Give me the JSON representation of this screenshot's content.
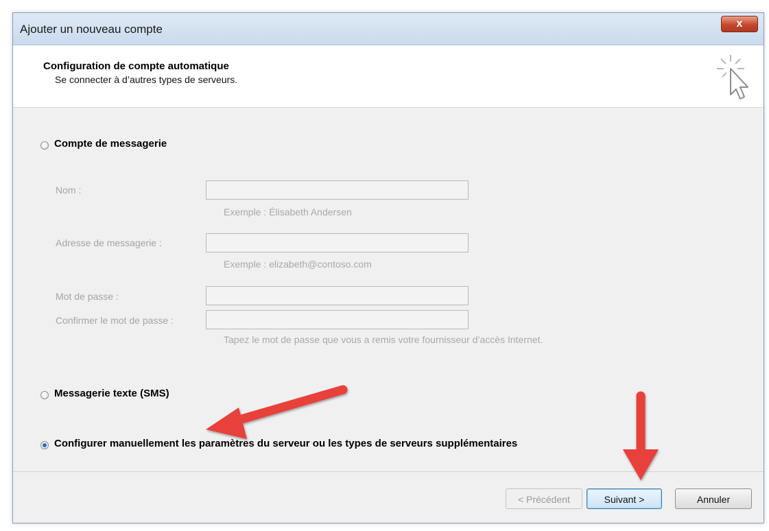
{
  "window": {
    "title": "Ajouter un nouveau compte",
    "close_glyph": "x"
  },
  "header": {
    "title": "Configuration de compte automatique",
    "subtitle": "Se connecter à d’autres types de serveurs.",
    "icon": "wizard-cursor-icon"
  },
  "options": {
    "email_account": {
      "label": "Compte de messagerie",
      "selected": false
    },
    "sms": {
      "label": "Messagerie texte (SMS)",
      "selected": false
    },
    "manual": {
      "label": "Configurer manuellement les paramètres du serveur ou les types de serveurs supplémentaires",
      "selected": true
    }
  },
  "form": {
    "name_label": "Nom :",
    "name_value": "",
    "name_hint": "Exemple : Élisabeth Andersen",
    "email_label": "Adresse de messagerie :",
    "email_value": "",
    "email_hint": "Exemple : elizabeth@contoso.com",
    "password_label": "Mot de passe :",
    "password_value": "",
    "confirm_label": "Confirmer le mot de passe :",
    "confirm_value": "",
    "password_hint": "Tapez le mot de passe que vous a remis votre fournisseur d’accès Internet."
  },
  "buttons": {
    "back": "< Précédent",
    "next": "Suivant >",
    "cancel": "Annuler"
  },
  "colors": {
    "annotation_arrow": "#e8403a",
    "selected_radio": "#2a6bc2"
  }
}
